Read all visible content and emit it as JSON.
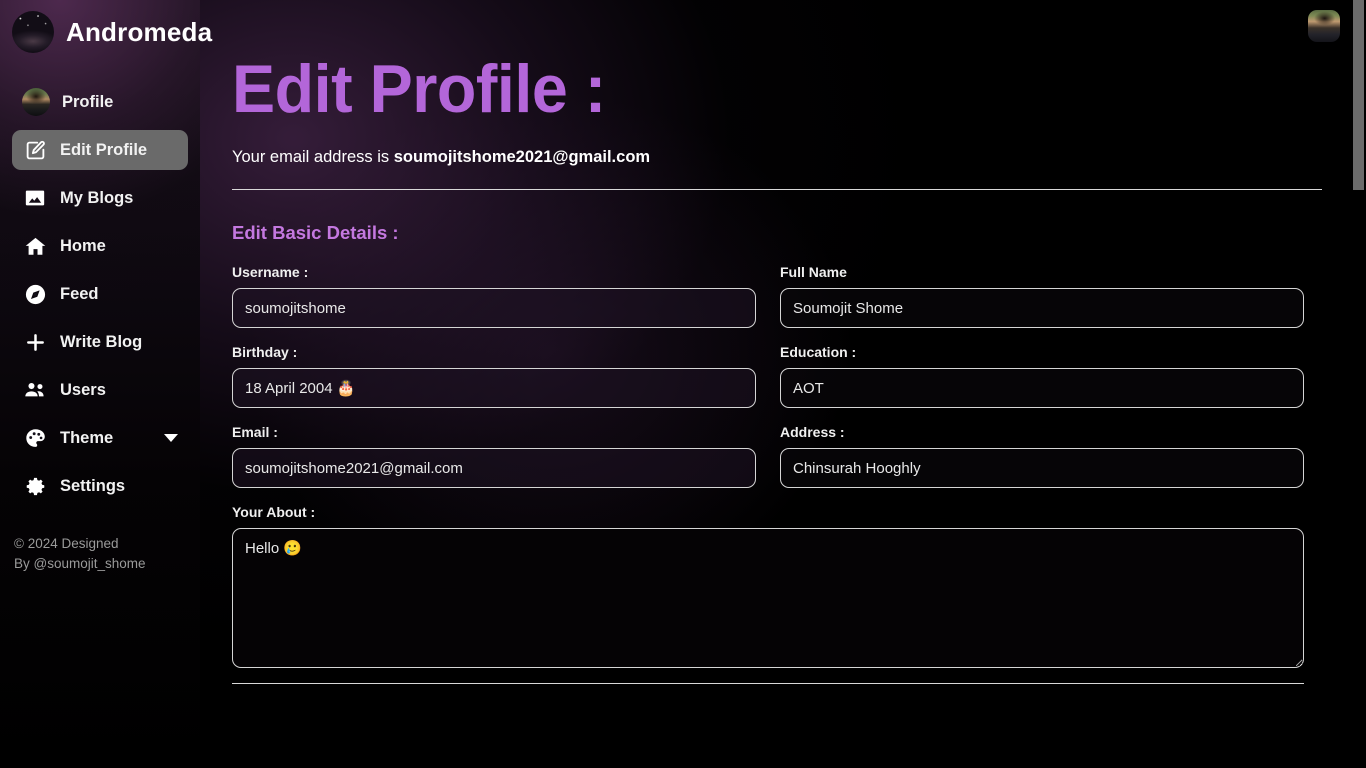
{
  "app": {
    "brand_name": "Andromeda",
    "logo_icon": "galaxy-photo",
    "topbar_avatar_icon": "user-avatar-photo"
  },
  "sidebar": {
    "items": [
      {
        "label": "Profile",
        "icon": "user-avatar-photo",
        "active": false,
        "has_chevron": false
      },
      {
        "label": "Edit Profile",
        "icon": "pencil-square-icon",
        "active": true,
        "has_chevron": false
      },
      {
        "label": "My Blogs",
        "icon": "image-icon",
        "active": false,
        "has_chevron": false
      },
      {
        "label": "Home",
        "icon": "house-icon",
        "active": false,
        "has_chevron": false
      },
      {
        "label": "Feed",
        "icon": "compass-icon",
        "active": false,
        "has_chevron": false
      },
      {
        "label": "Write Blog",
        "icon": "plus-icon",
        "active": false,
        "has_chevron": false
      },
      {
        "label": "Users",
        "icon": "people-group-icon",
        "active": false,
        "has_chevron": false
      },
      {
        "label": "Theme",
        "icon": "palette-icon",
        "active": false,
        "has_chevron": true
      },
      {
        "label": "Settings",
        "icon": "gear-icon",
        "active": false,
        "has_chevron": false
      }
    ],
    "footer_line1": "© 2024 Designed",
    "footer_line2": "By @soumojit_shome"
  },
  "main": {
    "page_title": "Edit Profile :",
    "email_prefix": "Your email address is ",
    "email_value": "soumojitshome2021@gmail.com",
    "section_title": "Edit Basic Details :",
    "fields": {
      "username": {
        "label": "Username :",
        "value": "soumojitshome",
        "placeholder": "Username"
      },
      "full_name": {
        "label": "Full Name",
        "value": "Soumojit Shome",
        "placeholder": "Full Name"
      },
      "birthday": {
        "label": "Birthday :",
        "value": "18 April 2004 🎂",
        "placeholder": "Birthday"
      },
      "education": {
        "label": "Education :",
        "value": "AOT",
        "placeholder": "Education"
      },
      "email": {
        "label": "Email :",
        "value": "soumojitshome2021@gmail.com",
        "placeholder": "Email"
      },
      "address": {
        "label": "Address :",
        "value": "Chinsurah Hooghly",
        "placeholder": "Address"
      },
      "about": {
        "label": "Your About :",
        "value": "Hello 🥲",
        "placeholder": "Your About"
      }
    }
  },
  "colors": {
    "accent_purple": "#b366d9",
    "section_purple": "#c478e0",
    "active_nav_bg": "#6a6a6a",
    "border_light": "#d5d5d5",
    "background": "#000000"
  },
  "scrollbar": {
    "thumb_icon": "scrollbar-thumb"
  }
}
